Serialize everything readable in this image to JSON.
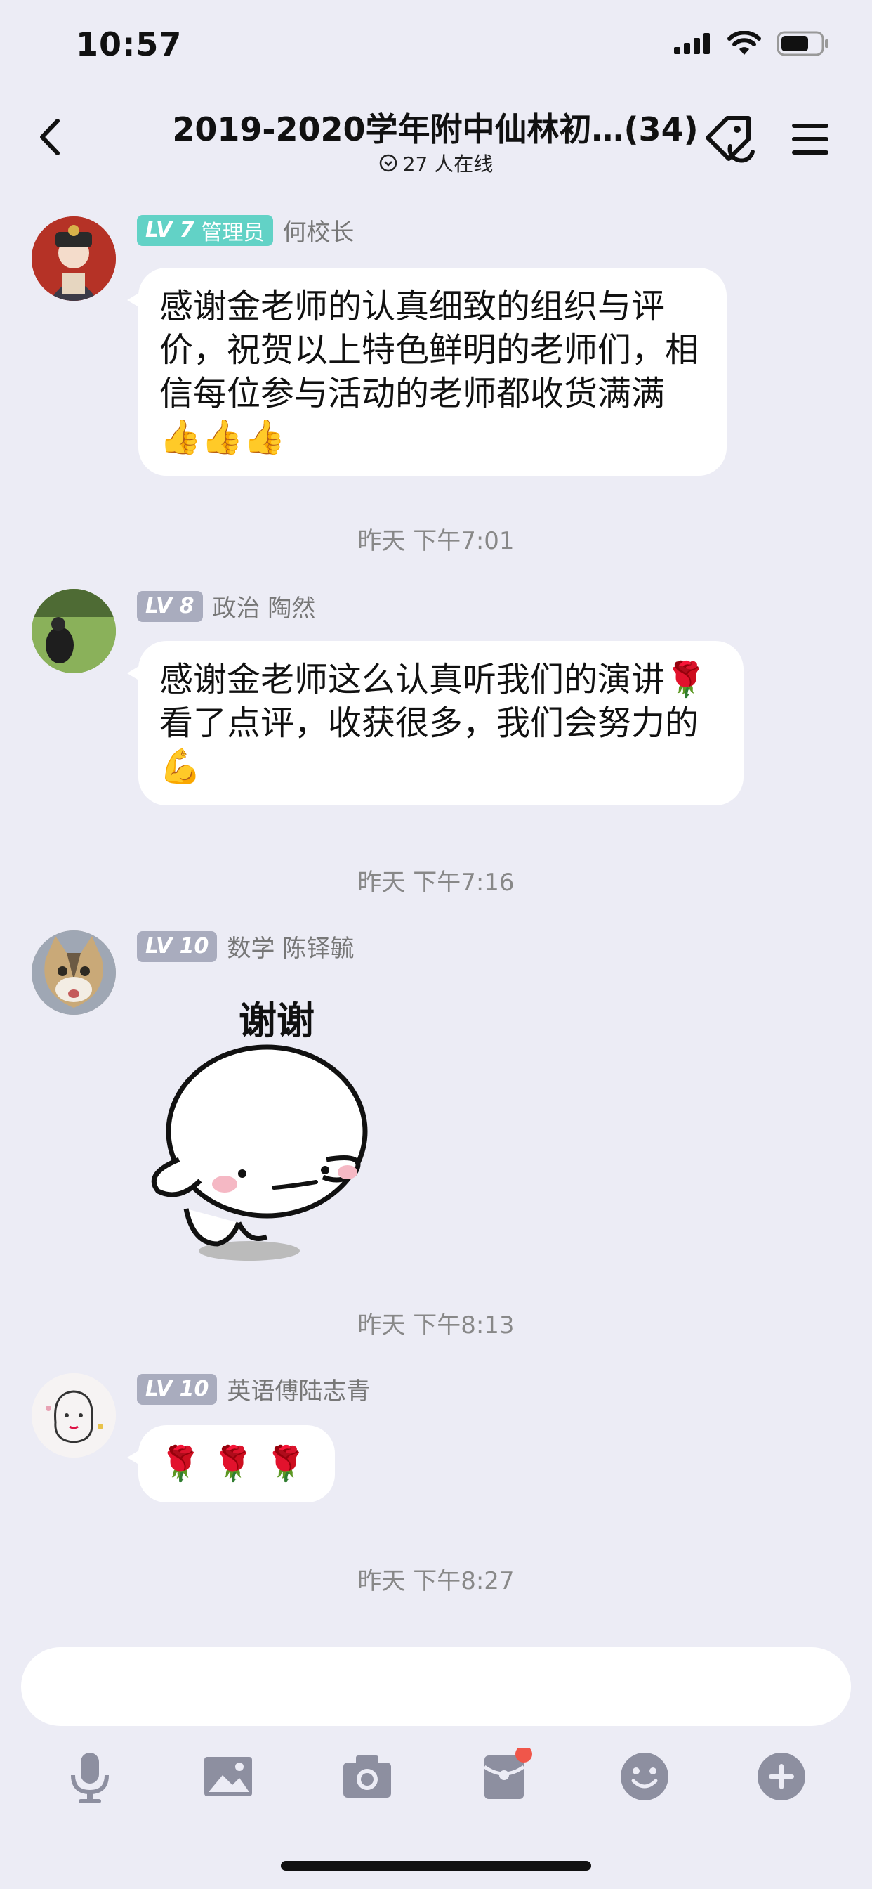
{
  "status_bar": {
    "time": "10:57"
  },
  "nav": {
    "title": "2019-2020学年附中仙林初…(34)",
    "online": "27 人在线"
  },
  "messages": [
    {
      "level": "LV 7",
      "role": "管理员",
      "name": "何校长",
      "text": "感谢金老师的认真细致的组织与评价，祝贺以上特色鲜明的老师们，相信每位参与活动的老师都收货满满 👍👍👍"
    },
    {
      "time": "昨天 下午7:01"
    },
    {
      "level": "LV 8",
      "name": "政治 陶然",
      "text": "感谢金老师这么认真听我们的演讲🌹看了点评，收获很多，我们会努力的💪"
    },
    {
      "time": "昨天 下午7:16"
    },
    {
      "level": "LV 10",
      "name": "数学 陈铎毓",
      "sticker_text": "谢谢"
    },
    {
      "time": "昨天 下午8:13"
    },
    {
      "level": "LV 10",
      "name": "英语傅陆志青",
      "text": "🌹 🌹 🌹"
    },
    {
      "time": "昨天 下午8:27"
    }
  ],
  "colors": {
    "background": "#ececf5",
    "admin_badge": "#62d2c6",
    "level_badge": "#a9acbe",
    "notification_dot": "#f0564a",
    "icon_gray": "#8d8fa0"
  },
  "icons": [
    "back-icon",
    "tag-icon",
    "menu-icon",
    "mic-icon",
    "image-icon",
    "camera-icon",
    "red-packet-icon",
    "emoji-icon",
    "plus-icon"
  ]
}
